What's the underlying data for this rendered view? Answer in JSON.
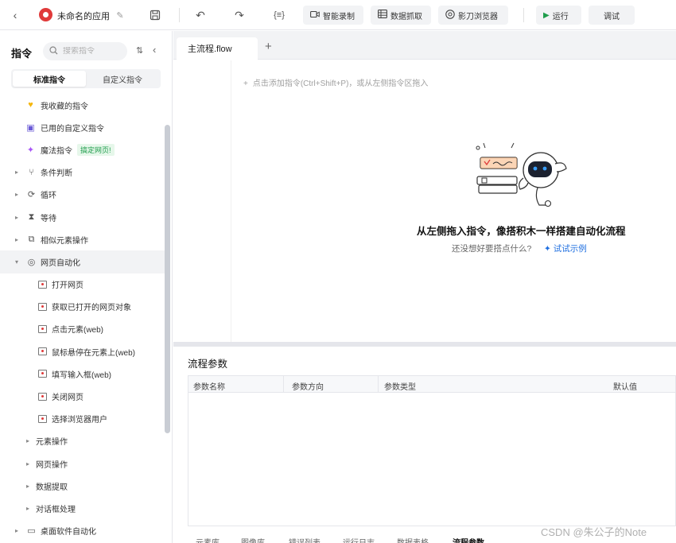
{
  "topbar": {
    "app_title": "未命名的应用",
    "buttons": {
      "smart_record": "智能录制",
      "data_capture": "数据抓取",
      "browser": "影刀浏览器",
      "run": "运行",
      "debug": "调试"
    }
  },
  "left_panel": {
    "title": "指令",
    "search_placeholder": "搜索指令",
    "tabs": [
      "标准指令",
      "自定义指令"
    ],
    "tree": [
      {
        "label": "我收藏的指令"
      },
      {
        "label": "已用的自定义指令"
      },
      {
        "label": "魔法指令",
        "tag": "搞定网页!"
      },
      {
        "label": "条件判断"
      },
      {
        "label": "循环"
      },
      {
        "label": "等待"
      },
      {
        "label": "相似元素操作"
      },
      {
        "label": "网页自动化"
      },
      {
        "label": "打开网页"
      },
      {
        "label": "获取已打开的网页对象"
      },
      {
        "label": "点击元素(web)"
      },
      {
        "label": "鼠标悬停在元素上(web)"
      },
      {
        "label": "填写输入框(web)"
      },
      {
        "label": "关闭网页"
      },
      {
        "label": "选择浏览器用户"
      },
      {
        "label": "元素操作"
      },
      {
        "label": "网页操作"
      },
      {
        "label": "数据提取"
      },
      {
        "label": "对话框处理"
      },
      {
        "label": "桌面软件自动化"
      }
    ]
  },
  "editor": {
    "file_tab": "主流程.flow",
    "hint": "点击添加指令(Ctrl+Shift+P)，或从左侧指令区拖入",
    "empty_title": "从左侧拖入指令，像搭积木一样搭建自动化流程",
    "empty_sub": "还没想好要搭点什么?",
    "try_link": "试试示例"
  },
  "params": {
    "title": "流程参数",
    "columns": [
      "参数名称",
      "参数方向",
      "参数类型",
      "默认值"
    ],
    "bottom_tabs": [
      "元素库",
      "图像库",
      "错误列表",
      "运行日志",
      "数据表格",
      "流程参数"
    ]
  },
  "watermark": "CSDN @朱公子的Note",
  "colors": {
    "accent_blue": "#1f6fe0",
    "run_green": "#1f9d4c",
    "logo_red": "#e03a3a",
    "favorite_gold": "#f5b70f"
  }
}
